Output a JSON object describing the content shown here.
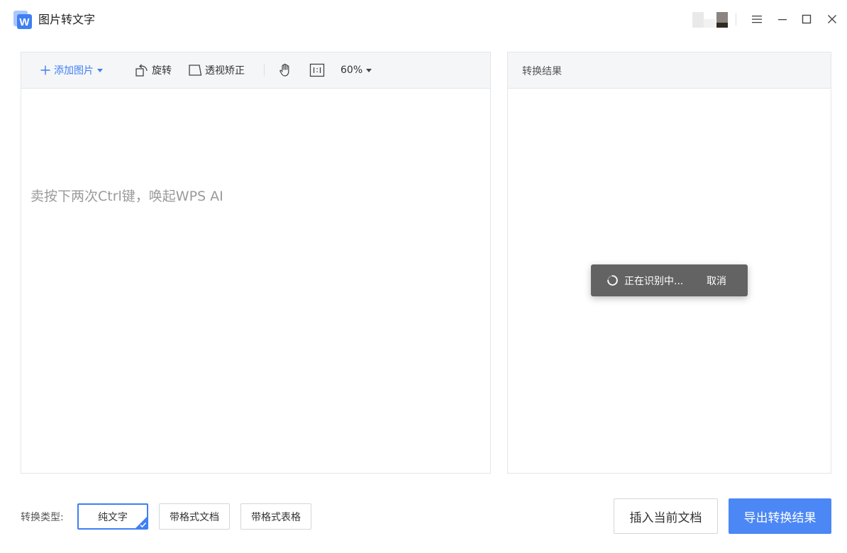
{
  "app": {
    "title": "图片转文字",
    "logo_letter": "W",
    "brand_color": "#3f7ff2"
  },
  "window_controls": {
    "menu_icon": "hamburger-icon",
    "minimize_icon": "minimize-icon",
    "maximize_icon": "maximize-icon",
    "close_icon": "close-icon"
  },
  "toolbar": {
    "add_image_label": "添加图片",
    "rotate_label": "旋转",
    "perspective_label": "透视矫正",
    "zoom_value": "60%"
  },
  "left_panel": {
    "hint_text": "卖按下两次Ctrl键，唤起WPS AI"
  },
  "right_panel": {
    "title": "转换结果"
  },
  "toast": {
    "status_text": "正在识别中...",
    "cancel_label": "取消"
  },
  "conversion": {
    "type_label": "转换类型:",
    "options": [
      "纯文字",
      "带格式文档",
      "带格式表格"
    ],
    "selected": "纯文字"
  },
  "actions": {
    "insert_label": "插入当前文档",
    "export_label": "导出转换结果"
  }
}
